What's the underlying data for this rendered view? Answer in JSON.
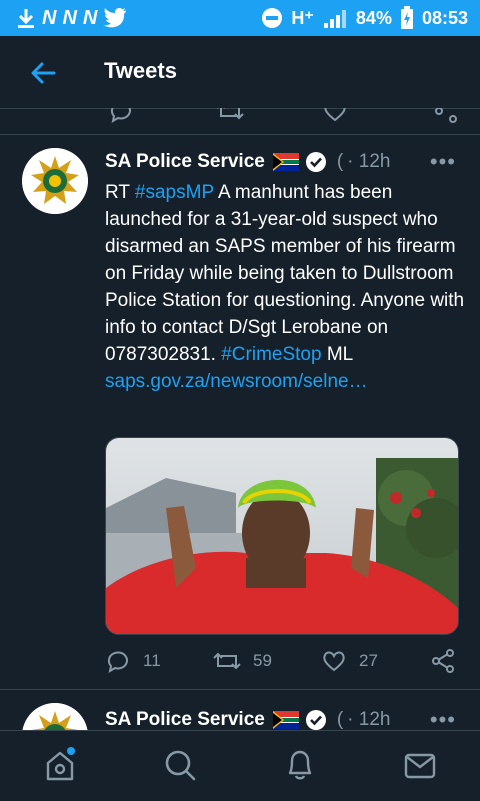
{
  "status_bar": {
    "left_icons": [
      "download-icon",
      "n-icon",
      "n-icon",
      "n-icon",
      "twitter-icon"
    ],
    "network": "H⁺",
    "battery": "84%",
    "time": "08:53"
  },
  "header": {
    "title": "Tweets",
    "back_icon": "arrow-left-icon"
  },
  "tweets": [
    {
      "author": "SA Police Service",
      "handle_truncated": "(",
      "time": "· 12h",
      "body_parts": [
        {
          "text": "RT ",
          "link": false
        },
        {
          "text": "#sapsMP",
          "link": true
        },
        {
          "text": " A manhunt has been launched for a 31-year-old suspect who disarmed an SAPS member of his firearm on Friday while being taken to Dullstroom Police Station for questioning. Anyone with info to contact D/Sgt Lerobane on 0787302831. ",
          "link": false
        },
        {
          "text": "#CrimeStop",
          "link": true
        },
        {
          "text": " ML",
          "link": false
        }
      ],
      "url": "saps.gov.za/newsroom/selne…",
      "actions": {
        "replies": "11",
        "retweets": "59",
        "likes": "27"
      }
    },
    {
      "author": "SA Police Service",
      "handle_truncated": "(",
      "time": "· 12h"
    }
  ],
  "bottom_nav": [
    "home-icon",
    "search-icon",
    "notifications-icon",
    "messages-icon"
  ],
  "colors": {
    "accent": "#1da1f2",
    "background": "#15202b",
    "muted": "#8899a6",
    "divider": "#38444d"
  }
}
